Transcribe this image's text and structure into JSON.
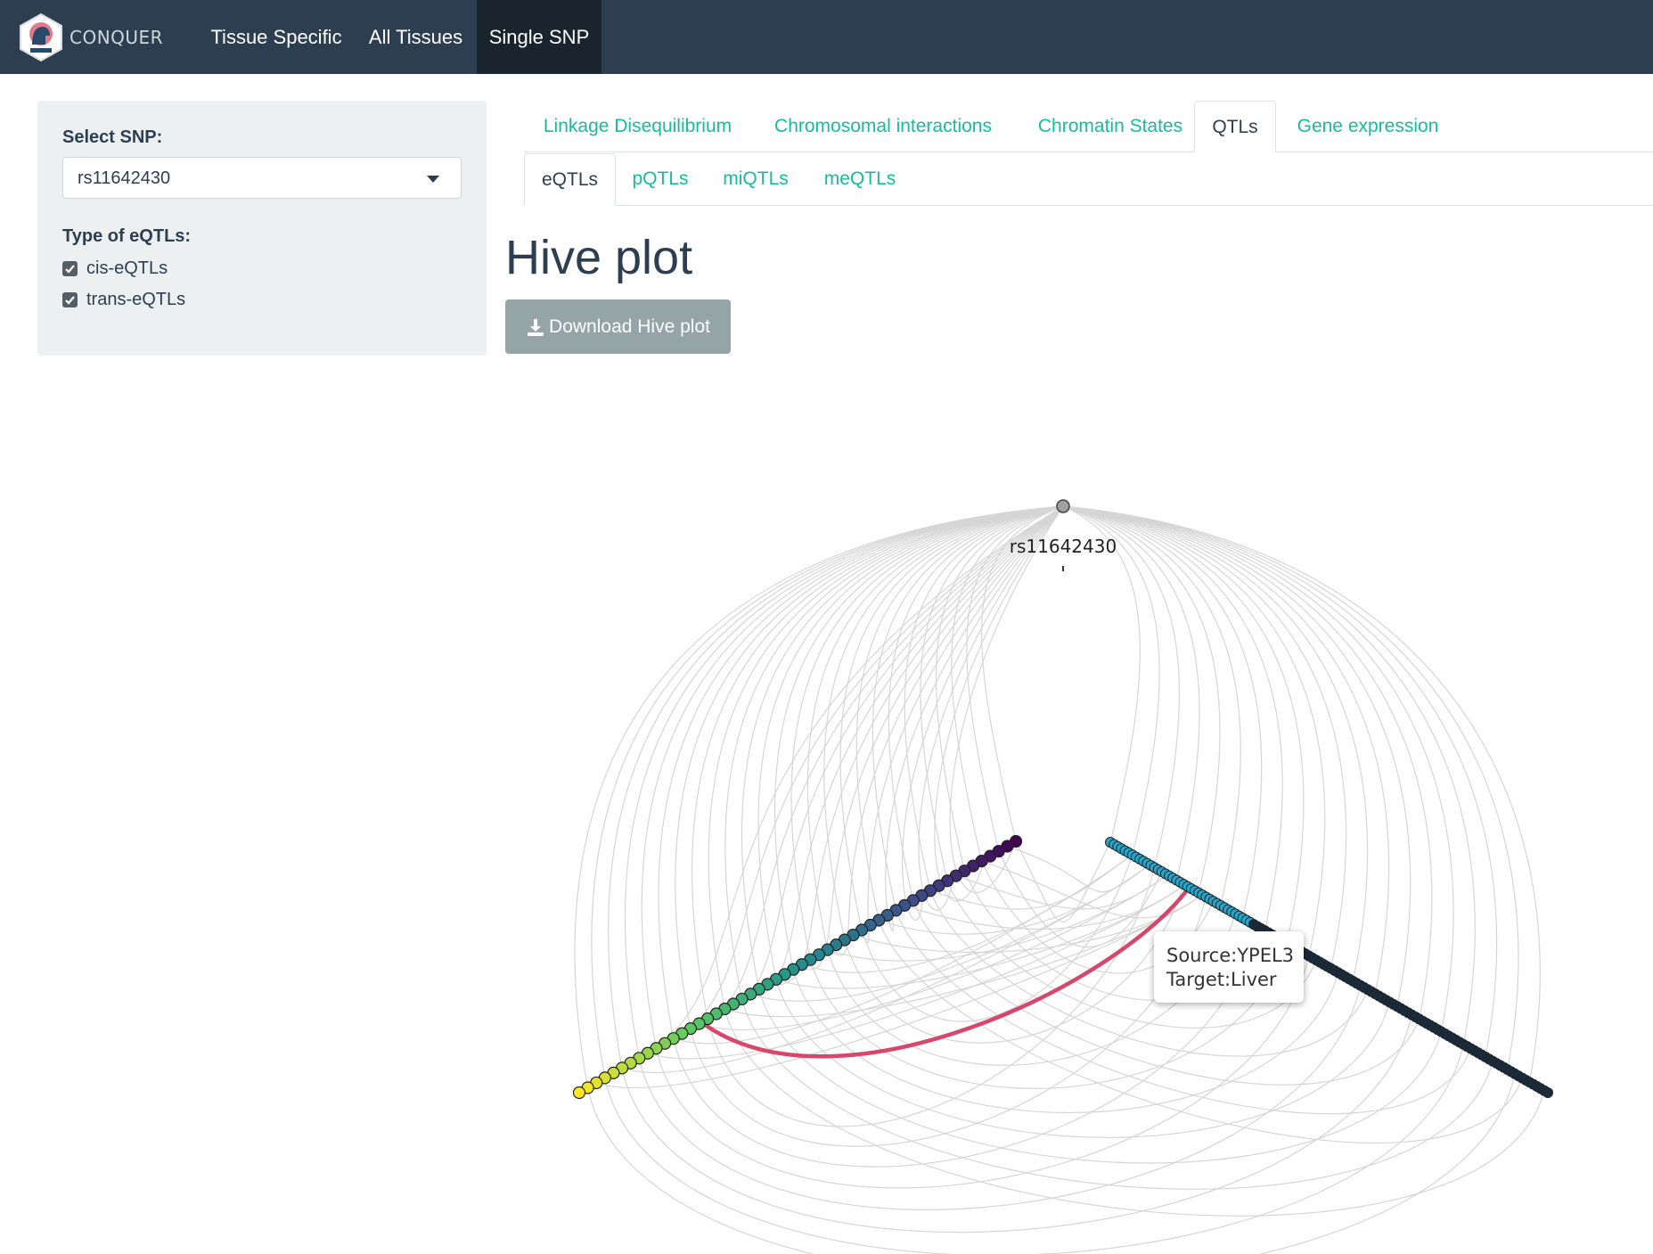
{
  "brand": {
    "name": "CONQUER"
  },
  "nav": {
    "items": [
      {
        "label": "Tissue Specific"
      },
      {
        "label": "All Tissues"
      },
      {
        "label": "Single SNP",
        "active": true
      }
    ]
  },
  "sidebar": {
    "select_label": "Select SNP:",
    "select_value": "rs11642430",
    "type_label": "Type of eQTLs:",
    "checkboxes": [
      {
        "label": "cis-eQTLs",
        "checked": true
      },
      {
        "label": "trans-eQTLs",
        "checked": true
      }
    ]
  },
  "tabs_main": [
    {
      "label": "Linkage Disequilibrium"
    },
    {
      "label": "Chromosomal interactions"
    },
    {
      "label": "Chromatin States"
    },
    {
      "label": "QTLs",
      "active": true
    },
    {
      "label": "Gene expression"
    }
  ],
  "tabs_sub": [
    {
      "label": "eQTLs",
      "active": true
    },
    {
      "label": "pQTLs"
    },
    {
      "label": "miQTLs"
    },
    {
      "label": "meQTLs"
    }
  ],
  "heading": "Hive plot",
  "download_button": {
    "label": "Download Hive plot",
    "icon": "download-icon"
  },
  "hive": {
    "snp_label": "rs11642430",
    "tooltip": {
      "source": "Source:YPEL3",
      "target": "Target:Liver"
    },
    "colors": {
      "edge": "#c8c8c8",
      "highlight": "#d6476b",
      "axis_right_top": "#29a5c7",
      "axis_right_bottom": "#1c2b3a",
      "snp_node": "#a0a0a0"
    },
    "left_axis_node_count": 52,
    "right_axis_node_count": 120
  }
}
